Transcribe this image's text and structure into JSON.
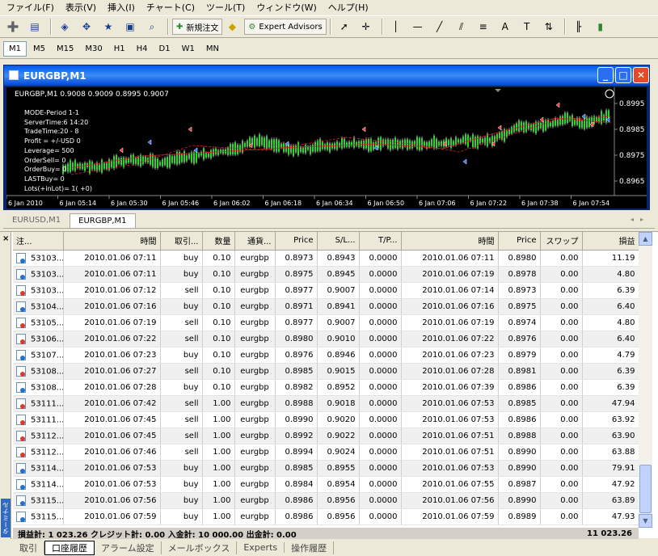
{
  "menu": [
    "ファイル(F)",
    "表示(V)",
    "挿入(I)",
    "チャート(C)",
    "ツール(T)",
    "ウィンドウ(W)",
    "ヘルプ(H)"
  ],
  "toolbar": {
    "new_order": "新規注文",
    "expert_advisors": "Expert Advisors"
  },
  "timeframes": [
    "M1",
    "M5",
    "M15",
    "M30",
    "H1",
    "H4",
    "D1",
    "W1",
    "MN"
  ],
  "active_timeframe": "M1",
  "chart_window": {
    "title": "EURGBP,M1",
    "info": "EURGBP,M1  0.9008 0.9009 0.8995 0.9007",
    "overlay": [
      "MODE-Period 1-1",
      "ServerTime:6 14:20",
      "TradeTime:20 - 8",
      "Profit = +/-USD 0",
      "Leverage=  500",
      "OrderSell= 0",
      "OrderBuy= 0",
      "LASTBuy= 0",
      "Lots(+inLot)= 1( +0)"
    ],
    "price_labels": [
      "0.8995",
      "0.8985",
      "0.8975",
      "0.8965"
    ],
    "time_labels": [
      "6 Jan 2010",
      "6 Jan 05:14",
      "6 Jan 05:30",
      "6 Jan 05:46",
      "6 Jan 06:02",
      "6 Jan 06:18",
      "6 Jan 06:34",
      "6 Jan 06:50",
      "6 Jan 07:06",
      "6 Jan 07:22",
      "6 Jan 07:38",
      "6 Jan 07:54"
    ]
  },
  "chart_tabs": [
    "EURUSD,M1",
    "EURGBP,M1"
  ],
  "active_chart_tab": "EURGBP,M1",
  "table": {
    "headers": [
      "注...",
      "時間",
      "取引...",
      "数量",
      "通貨...",
      "Price",
      "S/L...",
      "T/P...",
      "時間",
      "Price",
      "スワップ",
      "損益"
    ],
    "rows": [
      {
        "order": "53103...",
        "open_time": "2010.01.06 07:11",
        "type": "buy",
        "lots": "0.10",
        "symbol": "eurgbp",
        "price": "0.8973",
        "sl": "0.8943",
        "tp": "0.0000",
        "close_time": "2010.01.06 07:11",
        "close_price": "0.8980",
        "swap": "0.00",
        "profit": "11.19"
      },
      {
        "order": "53103...",
        "open_time": "2010.01.06 07:11",
        "type": "buy",
        "lots": "0.10",
        "symbol": "eurgbp",
        "price": "0.8975",
        "sl": "0.8945",
        "tp": "0.0000",
        "close_time": "2010.01.06 07:19",
        "close_price": "0.8978",
        "swap": "0.00",
        "profit": "4.80"
      },
      {
        "order": "53103...",
        "open_time": "2010.01.06 07:12",
        "type": "sell",
        "lots": "0.10",
        "symbol": "eurgbp",
        "price": "0.8977",
        "sl": "0.9007",
        "tp": "0.0000",
        "close_time": "2010.01.06 07:14",
        "close_price": "0.8973",
        "swap": "0.00",
        "profit": "6.39"
      },
      {
        "order": "53104...",
        "open_time": "2010.01.06 07:16",
        "type": "buy",
        "lots": "0.10",
        "symbol": "eurgbp",
        "price": "0.8971",
        "sl": "0.8941",
        "tp": "0.0000",
        "close_time": "2010.01.06 07:16",
        "close_price": "0.8975",
        "swap": "0.00",
        "profit": "6.40"
      },
      {
        "order": "53105...",
        "open_time": "2010.01.06 07:19",
        "type": "sell",
        "lots": "0.10",
        "symbol": "eurgbp",
        "price": "0.8977",
        "sl": "0.9007",
        "tp": "0.0000",
        "close_time": "2010.01.06 07:19",
        "close_price": "0.8974",
        "swap": "0.00",
        "profit": "4.80"
      },
      {
        "order": "53106...",
        "open_time": "2010.01.06 07:22",
        "type": "sell",
        "lots": "0.10",
        "symbol": "eurgbp",
        "price": "0.8980",
        "sl": "0.9010",
        "tp": "0.0000",
        "close_time": "2010.01.06 07:22",
        "close_price": "0.8976",
        "swap": "0.00",
        "profit": "6.40"
      },
      {
        "order": "53107...",
        "open_time": "2010.01.06 07:23",
        "type": "buy",
        "lots": "0.10",
        "symbol": "eurgbp",
        "price": "0.8976",
        "sl": "0.8946",
        "tp": "0.0000",
        "close_time": "2010.01.06 07:23",
        "close_price": "0.8979",
        "swap": "0.00",
        "profit": "4.79"
      },
      {
        "order": "53108...",
        "open_time": "2010.01.06 07:27",
        "type": "sell",
        "lots": "0.10",
        "symbol": "eurgbp",
        "price": "0.8985",
        "sl": "0.9015",
        "tp": "0.0000",
        "close_time": "2010.01.06 07:28",
        "close_price": "0.8981",
        "swap": "0.00",
        "profit": "6.39"
      },
      {
        "order": "53108...",
        "open_time": "2010.01.06 07:28",
        "type": "buy",
        "lots": "0.10",
        "symbol": "eurgbp",
        "price": "0.8982",
        "sl": "0.8952",
        "tp": "0.0000",
        "close_time": "2010.01.06 07:39",
        "close_price": "0.8986",
        "swap": "0.00",
        "profit": "6.39"
      },
      {
        "order": "53111...",
        "open_time": "2010.01.06 07:42",
        "type": "sell",
        "lots": "1.00",
        "symbol": "eurgbp",
        "price": "0.8988",
        "sl": "0.9018",
        "tp": "0.0000",
        "close_time": "2010.01.06 07:53",
        "close_price": "0.8985",
        "swap": "0.00",
        "profit": "47.94"
      },
      {
        "order": "53111...",
        "open_time": "2010.01.06 07:45",
        "type": "sell",
        "lots": "1.00",
        "symbol": "eurgbp",
        "price": "0.8990",
        "sl": "0.9020",
        "tp": "0.0000",
        "close_time": "2010.01.06 07:53",
        "close_price": "0.8986",
        "swap": "0.00",
        "profit": "63.92"
      },
      {
        "order": "53112...",
        "open_time": "2010.01.06 07:45",
        "type": "sell",
        "lots": "1.00",
        "symbol": "eurgbp",
        "price": "0.8992",
        "sl": "0.9022",
        "tp": "0.0000",
        "close_time": "2010.01.06 07:51",
        "close_price": "0.8988",
        "swap": "0.00",
        "profit": "63.90"
      },
      {
        "order": "53112...",
        "open_time": "2010.01.06 07:46",
        "type": "sell",
        "lots": "1.00",
        "symbol": "eurgbp",
        "price": "0.8994",
        "sl": "0.9024",
        "tp": "0.0000",
        "close_time": "2010.01.06 07:51",
        "close_price": "0.8990",
        "swap": "0.00",
        "profit": "63.88"
      },
      {
        "order": "53114...",
        "open_time": "2010.01.06 07:53",
        "type": "buy",
        "lots": "1.00",
        "symbol": "eurgbp",
        "price": "0.8985",
        "sl": "0.8955",
        "tp": "0.0000",
        "close_time": "2010.01.06 07:53",
        "close_price": "0.8990",
        "swap": "0.00",
        "profit": "79.91"
      },
      {
        "order": "53114...",
        "open_time": "2010.01.06 07:53",
        "type": "buy",
        "lots": "1.00",
        "symbol": "eurgbp",
        "price": "0.8984",
        "sl": "0.8954",
        "tp": "0.0000",
        "close_time": "2010.01.06 07:55",
        "close_price": "0.8987",
        "swap": "0.00",
        "profit": "47.92"
      },
      {
        "order": "53115...",
        "open_time": "2010.01.06 07:56",
        "type": "buy",
        "lots": "1.00",
        "symbol": "eurgbp",
        "price": "0.8986",
        "sl": "0.8956",
        "tp": "0.0000",
        "close_time": "2010.01.06 07:56",
        "close_price": "0.8990",
        "swap": "0.00",
        "profit": "63.89"
      },
      {
        "order": "53115...",
        "open_time": "2010.01.06 07:59",
        "type": "buy",
        "lots": "1.00",
        "symbol": "eurgbp",
        "price": "0.8986",
        "sl": "0.8956",
        "tp": "0.0000",
        "close_time": "2010.01.06 07:59",
        "close_price": "0.8989",
        "swap": "0.00",
        "profit": "47.93"
      }
    ]
  },
  "summary": {
    "text": "損益計: 1 023.26  クレジット計: 0.00  入金計: 10 000.00  出金計: 0.00",
    "total": "11 023.26"
  },
  "terminal_label": "ターミナル",
  "bottom_tabs": [
    "取引",
    "口座履歴",
    "アラーム設定",
    "メールボックス",
    "Experts",
    "操作履歴"
  ],
  "active_bottom_tab": "口座履歴"
}
